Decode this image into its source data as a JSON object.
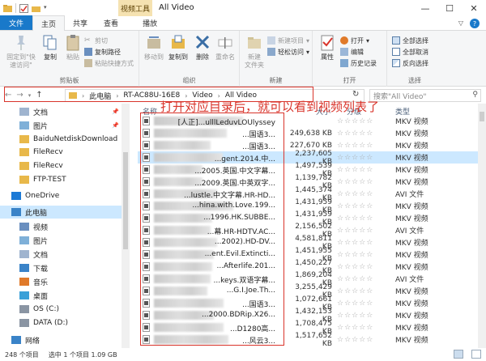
{
  "window": {
    "title": "All Video",
    "context_tab": "视频工具",
    "buttons": {
      "minimize": "—",
      "maximize": "☐",
      "close": "✕"
    }
  },
  "ribbon_tabs": [
    "文件",
    "主页",
    "共享",
    "查看",
    "播放"
  ],
  "ribbon": {
    "clipboard": {
      "label": "剪贴板",
      "pin": "固定到\"快\n速访问\"",
      "copy": "复制",
      "paste": "粘贴",
      "cut": "剪切",
      "copy_path": "复制路径",
      "paste_shortcut": "粘贴快捷方式"
    },
    "organize": {
      "label": "组织",
      "move_to": "移动到",
      "copy_to": "复制到",
      "delete": "删除",
      "rename": "重命名"
    },
    "new": {
      "label": "新建",
      "new_folder": "新建\n文件夹",
      "new_item": "新建项目",
      "easy_access": "轻松访问"
    },
    "open": {
      "label": "打开",
      "properties": "属性",
      "open": "打开",
      "edit": "编辑",
      "history": "历史记录"
    },
    "select": {
      "label": "选择",
      "select_all": "全部选择",
      "select_none": "全部取消",
      "invert": "反向选择"
    }
  },
  "address": {
    "crumbs": [
      "此电脑",
      "RT-AC88U-16E8",
      "Video",
      "All Video"
    ],
    "search_placeholder": "搜索\"All Video\""
  },
  "annotation": "打开对应目录后，就可以看到视频列表了",
  "nav_pane": [
    {
      "label": "文档",
      "icon": "document-folder-icon",
      "pinned": true
    },
    {
      "label": "图片",
      "icon": "pictures-folder-icon",
      "pinned": true
    },
    {
      "label": "BaiduNetdiskDownload",
      "icon": "folder-icon"
    },
    {
      "label": "FileRecv",
      "icon": "folder-icon"
    },
    {
      "label": "FileRecv",
      "icon": "folder-icon"
    },
    {
      "label": "FTP-TEST",
      "icon": "folder-icon"
    },
    {
      "label": "OneDrive",
      "icon": "cloud-icon"
    },
    {
      "label": "此电脑",
      "icon": "computer-icon",
      "selected": true
    },
    {
      "label": "视频",
      "icon": "video-folder-icon"
    },
    {
      "label": "图片",
      "icon": "pictures-folder-icon"
    },
    {
      "label": "文档",
      "icon": "document-folder-icon"
    },
    {
      "label": "下载",
      "icon": "download-folder-icon"
    },
    {
      "label": "音乐",
      "icon": "music-folder-icon"
    },
    {
      "label": "桌面",
      "icon": "desktop-folder-icon"
    },
    {
      "label": "OS (C:)",
      "icon": "drive-icon"
    },
    {
      "label": "DATA (D:)",
      "icon": "drive-icon"
    },
    {
      "label": "网络",
      "icon": "network-icon"
    }
  ],
  "columns": {
    "name": "名称",
    "size": "大小",
    "rating": "分级",
    "type": "类型"
  },
  "files": [
    {
      "name": "[人正]...ulllLeduvLOUlyssey",
      "size": "",
      "type": "MKV 视频"
    },
    {
      "name": "...国语3...",
      "size": "249,638 KB",
      "type": "MKV 视频"
    },
    {
      "name": "...国语3...",
      "size": "227,670 KB",
      "type": "MKV 视频"
    },
    {
      "name": "...gent.2014.中...",
      "size": "2,237,605 KB",
      "type": "MKV 视频",
      "selected": true
    },
    {
      "name": "...2005.英国.中文字幕...",
      "size": "1,497,539 KB",
      "type": "MKV 视频"
    },
    {
      "name": "...2009.英国.中英双字...",
      "size": "1,139,782 KB",
      "type": "MKV 视频"
    },
    {
      "name": "...lustle.中文字幕.HR-HD...",
      "size": "1,445,374 KB",
      "type": "AVI 文件"
    },
    {
      "name": "...hina.with.Love.199...",
      "size": "1,431,959 KB",
      "type": "MKV 视频"
    },
    {
      "name": "...1996.HK.SUBBE...",
      "size": "1,431,959 KB",
      "type": "MKV 视频"
    },
    {
      "name": "...幕.HR-HDTV.AC...",
      "size": "2,156,502 KB",
      "type": "AVI 文件"
    },
    {
      "name": "...2002).HD-DV...",
      "size": "4,581,811 KB",
      "type": "MKV 视频"
    },
    {
      "name": "...ent.Evil.Extincti...",
      "size": "1,451,955 KB",
      "type": "MKV 视频"
    },
    {
      "name": "...Afterlife.201...",
      "size": "1,450,227 KB",
      "type": "MKV 视频"
    },
    {
      "name": "...keys.双语字幕...",
      "size": "1,869,204 KB",
      "type": "AVI 文件"
    },
    {
      "name": "...G.I.Joe.Th...",
      "size": "3,255,429 KB",
      "type": "MKV 视频"
    },
    {
      "name": "...国语3...",
      "size": "1,072,661 KB",
      "type": "MKV 视频"
    },
    {
      "name": "...2000.BDRip.X26...",
      "size": "1,432,153 KB",
      "type": "MKV 视频"
    },
    {
      "name": "...D1280高...",
      "size": "1,708,475 KB",
      "type": "MKV 视频"
    },
    {
      "name": "...风云3...",
      "size": "1,517,652 KB",
      "type": "MKV 视频"
    }
  ],
  "rating_stars": "☆☆☆☆☆",
  "status": {
    "count": "248 个项目",
    "selection": "选中 1 个项目  1.09 GB"
  }
}
